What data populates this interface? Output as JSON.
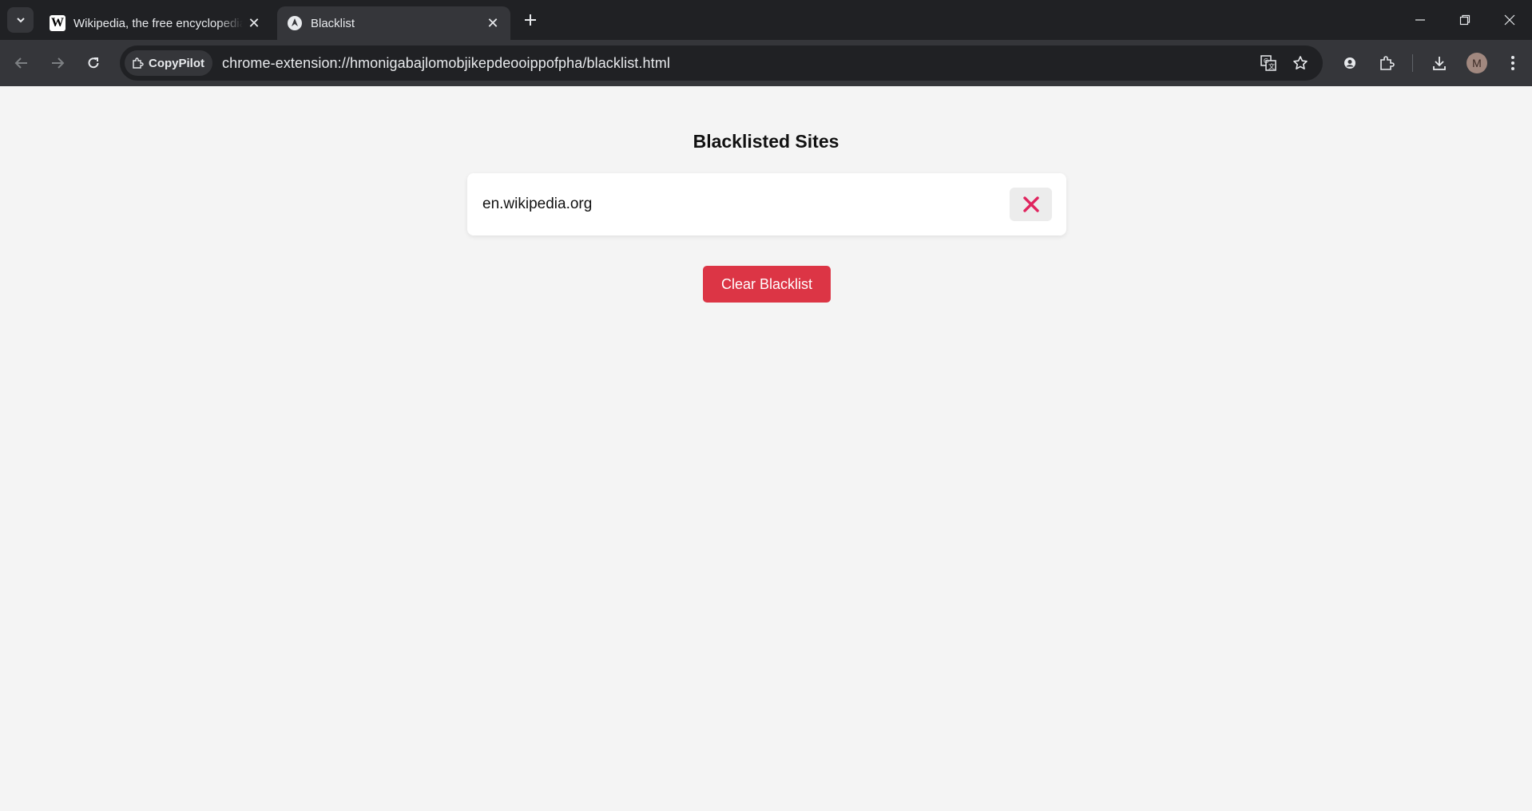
{
  "browser": {
    "tabs": [
      {
        "title": "Wikipedia, the free encyclopedia",
        "favicon": "wikipedia-icon",
        "active": false
      },
      {
        "title": "Blacklist",
        "favicon": "extension-icon",
        "active": true
      }
    ],
    "omnibox": {
      "chip_label": "CopyPilot",
      "url": "chrome-extension://hmonigabajlomobjikepdeooippofpha/blacklist.html"
    },
    "avatar_initial": "M"
  },
  "page": {
    "title": "Blacklisted Sites",
    "sites": [
      {
        "domain": "en.wikipedia.org"
      }
    ],
    "clear_button_label": "Clear Blacklist"
  },
  "colors": {
    "danger": "#dc3545",
    "remove_icon": "#e0245e"
  }
}
